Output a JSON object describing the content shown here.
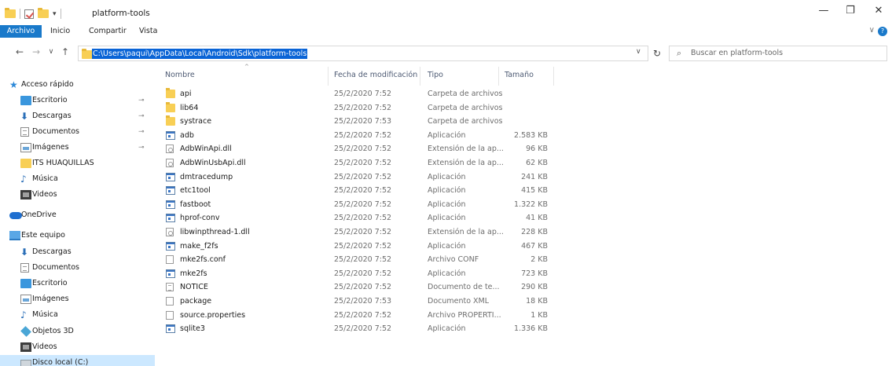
{
  "window": {
    "title": "platform-tools",
    "controls": {
      "minimize": "—",
      "restore": "❐",
      "close": "✕"
    }
  },
  "quick_access_toolbar": {
    "dropdown": "▾"
  },
  "ribbon": {
    "tabs": [
      "Archivo",
      "Inicio",
      "Compartir",
      "Vista"
    ],
    "expand": "∨",
    "help": "?"
  },
  "address": {
    "back": "←",
    "forward": "→",
    "recent": "∨",
    "up": "↑",
    "path": "C:\\Users\\paqui\\AppData\\Local\\Android\\Sdk\\platform-tools",
    "dropdown": "∨",
    "refresh": "↻",
    "search_placeholder": "Buscar en platform-tools",
    "search_icon": "⌕"
  },
  "nav": {
    "pin_glyph": "⊸",
    "items": [
      {
        "label": "Acceso rápido",
        "icon": "star-icon",
        "pinned": false
      },
      {
        "label": "Escritorio",
        "icon": "desktop-icon",
        "pinned": true
      },
      {
        "label": "Descargas",
        "icon": "downloads-icon",
        "pinned": true
      },
      {
        "label": "Documentos",
        "icon": "documents-icon",
        "pinned": true
      },
      {
        "label": "Imágenes",
        "icon": "pictures-icon",
        "pinned": true
      },
      {
        "label": "ITS HUAQUILLAS",
        "icon": "folder-icon",
        "pinned": false
      },
      {
        "label": "Música",
        "icon": "music-icon",
        "pinned": false
      },
      {
        "label": "Videos",
        "icon": "videos-icon",
        "pinned": false
      },
      {
        "label": "OneDrive",
        "icon": "onedrive-icon",
        "pinned": false
      },
      {
        "label": "Este equipo",
        "icon": "this-pc-icon",
        "pinned": false
      },
      {
        "label": "Descargas",
        "icon": "downloads-icon",
        "pinned": false
      },
      {
        "label": "Documentos",
        "icon": "documents-icon",
        "pinned": false
      },
      {
        "label": "Escritorio",
        "icon": "desktop-icon",
        "pinned": false
      },
      {
        "label": "Imágenes",
        "icon": "pictures-icon",
        "pinned": false
      },
      {
        "label": "Música",
        "icon": "music-icon",
        "pinned": false
      },
      {
        "label": "Objetos 3D",
        "icon": "3d-objects-icon",
        "pinned": false
      },
      {
        "label": "Videos",
        "icon": "videos-icon",
        "pinned": false
      },
      {
        "label": "Disco local (C:)",
        "icon": "local-disk-icon",
        "pinned": false,
        "selected": true
      }
    ]
  },
  "columns": {
    "name": "Nombre",
    "date": "Fecha de modificación",
    "type": "Tipo",
    "size": "Tamaño",
    "sort_indicator": "^"
  },
  "files": [
    {
      "name": "api",
      "date": "25/2/2020 7:52",
      "type": "Carpeta de archivos",
      "size": "",
      "icon": "folder-icon"
    },
    {
      "name": "lib64",
      "date": "25/2/2020 7:52",
      "type": "Carpeta de archivos",
      "size": "",
      "icon": "folder-icon"
    },
    {
      "name": "systrace",
      "date": "25/2/2020 7:53",
      "type": "Carpeta de archivos",
      "size": "",
      "icon": "folder-icon"
    },
    {
      "name": "adb",
      "date": "25/2/2020 7:52",
      "type": "Aplicación",
      "size": "2.583 KB",
      "icon": "application-icon"
    },
    {
      "name": "AdbWinApi.dll",
      "date": "25/2/2020 7:52",
      "type": "Extensión de la ap...",
      "size": "96 KB",
      "icon": "dll-icon"
    },
    {
      "name": "AdbWinUsbApi.dll",
      "date": "25/2/2020 7:52",
      "type": "Extensión de la ap...",
      "size": "62 KB",
      "icon": "dll-icon"
    },
    {
      "name": "dmtracedump",
      "date": "25/2/2020 7:52",
      "type": "Aplicación",
      "size": "241 KB",
      "icon": "application-icon"
    },
    {
      "name": "etc1tool",
      "date": "25/2/2020 7:52",
      "type": "Aplicación",
      "size": "415 KB",
      "icon": "application-icon"
    },
    {
      "name": "fastboot",
      "date": "25/2/2020 7:52",
      "type": "Aplicación",
      "size": "1.322 KB",
      "icon": "application-icon"
    },
    {
      "name": "hprof-conv",
      "date": "25/2/2020 7:52",
      "type": "Aplicación",
      "size": "41 KB",
      "icon": "application-icon"
    },
    {
      "name": "libwinpthread-1.dll",
      "date": "25/2/2020 7:52",
      "type": "Extensión de la ap...",
      "size": "228 KB",
      "icon": "dll-icon"
    },
    {
      "name": "make_f2fs",
      "date": "25/2/2020 7:52",
      "type": "Aplicación",
      "size": "467 KB",
      "icon": "application-icon"
    },
    {
      "name": "mke2fs.conf",
      "date": "25/2/2020 7:52",
      "type": "Archivo CONF",
      "size": "2 KB",
      "icon": "file-icon"
    },
    {
      "name": "mke2fs",
      "date": "25/2/2020 7:52",
      "type": "Aplicación",
      "size": "723 KB",
      "icon": "application-icon"
    },
    {
      "name": "NOTICE",
      "date": "25/2/2020 7:52",
      "type": "Documento de te...",
      "size": "290 KB",
      "icon": "text-document-icon"
    },
    {
      "name": "package",
      "date": "25/2/2020 7:53",
      "type": "Documento XML",
      "size": "18 KB",
      "icon": "file-icon"
    },
    {
      "name": "source.properties",
      "date": "25/2/2020 7:52",
      "type": "Archivo PROPERTI...",
      "size": "1 KB",
      "icon": "file-icon"
    },
    {
      "name": "sqlite3",
      "date": "25/2/2020 7:52",
      "type": "Aplicación",
      "size": "1.336 KB",
      "icon": "application-icon"
    }
  ],
  "colors": {
    "accent": "#1979ca",
    "selection": "#cce8ff",
    "address_highlight": "#0a64d6",
    "folder": "#f8cf55"
  }
}
